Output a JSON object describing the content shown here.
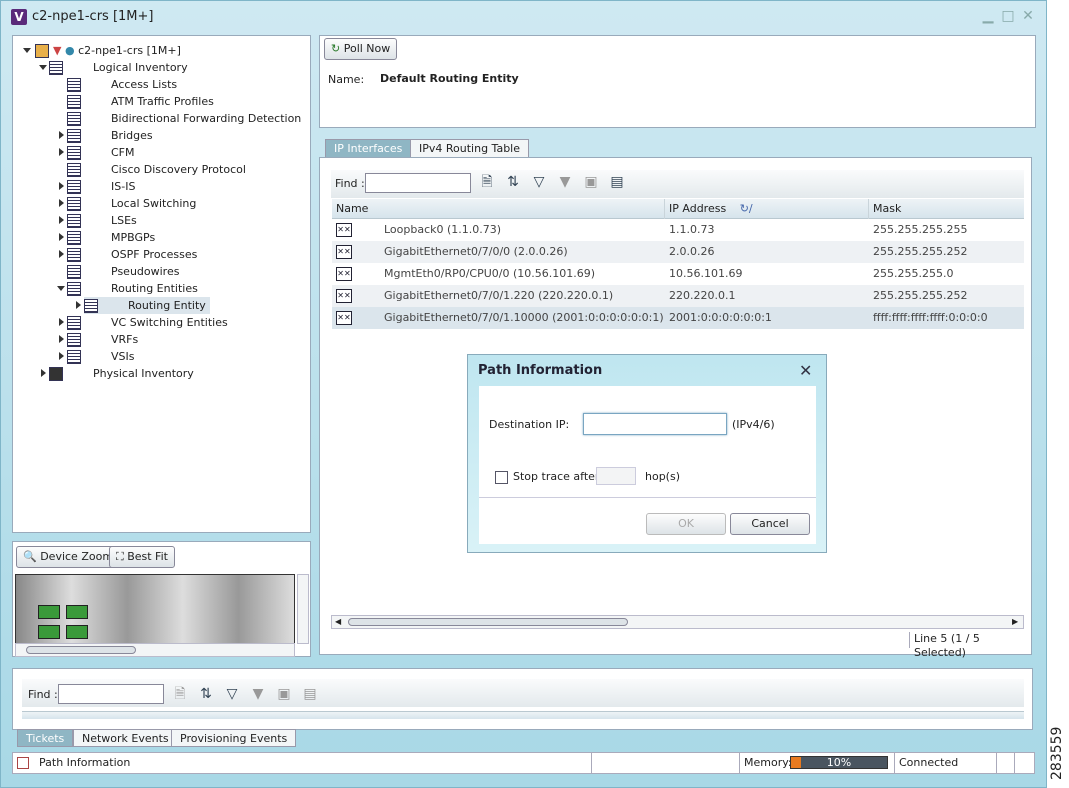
{
  "window": {
    "title": "c2-npe1-crs [1M+]",
    "app_icon": "V"
  },
  "tree": {
    "root": "c2-npe1-crs [1M+]",
    "items": [
      {
        "label": "Logical Inventory",
        "level": 1
      },
      {
        "label": "Access Lists",
        "level": 2
      },
      {
        "label": "ATM Traffic Profiles",
        "level": 2
      },
      {
        "label": "Bidirectional Forwarding Detection",
        "level": 2
      },
      {
        "label": "Bridges",
        "level": 2
      },
      {
        "label": "CFM",
        "level": 2
      },
      {
        "label": "Cisco Discovery Protocol",
        "level": 2
      },
      {
        "label": "IS-IS",
        "level": 2
      },
      {
        "label": "Local Switching",
        "level": 2
      },
      {
        "label": "LSEs",
        "level": 2
      },
      {
        "label": "MPBGPs",
        "level": 2
      },
      {
        "label": "OSPF Processes",
        "level": 2
      },
      {
        "label": "Pseudowires",
        "level": 2
      },
      {
        "label": "Routing Entities",
        "level": 2
      },
      {
        "label": "Routing Entity",
        "level": 3
      },
      {
        "label": "VC Switching Entities",
        "level": 2
      },
      {
        "label": "VRFs",
        "level": 2
      },
      {
        "label": "VSIs",
        "level": 2
      },
      {
        "label": "Physical Inventory",
        "level": 1
      }
    ]
  },
  "overview": {
    "device_zoom": "Device Zoom",
    "best_fit": "Best Fit"
  },
  "details": {
    "poll_now": "Poll Now",
    "name_label": "Name:",
    "name_value": "Default Routing Entity"
  },
  "tabs": {
    "ip_interfaces": "IP Interfaces",
    "ipv4_routing": "IPv4 Routing Table"
  },
  "find": {
    "label": "Find :"
  },
  "table": {
    "headers": [
      "Name",
      "IP Address",
      "Mask"
    ],
    "rows": [
      [
        "Loopback0 (1.1.0.73)",
        "1.1.0.73",
        "255.255.255.255"
      ],
      [
        "GigabitEthernet0/7/0/0 (2.0.0.26)",
        "2.0.0.26",
        "255.255.255.252"
      ],
      [
        "MgmtEth0/RP0/CPU0/0 (10.56.101.69)",
        "10.56.101.69",
        "255.255.255.0"
      ],
      [
        "GigabitEthernet0/7/0/1.220 (220.220.0.1)",
        "220.220.0.1",
        "255.255.255.252"
      ],
      [
        "GigabitEthernet0/7/0/1.10000 (2001:0:0:0:0:0:0:1)",
        "2001:0:0:0:0:0:0:1",
        "ffff:ffff:ffff:ffff:0:0:0:0"
      ]
    ],
    "status": "Line 5 (1 / 5 Selected)"
  },
  "dialog": {
    "title": "Path Information",
    "dest_label": "Destination IP:",
    "dest_value": "",
    "dest_suffix": "(IPv4/6)",
    "stop_label": "Stop trace after",
    "hops_suffix": "hop(s)",
    "ok": "OK",
    "cancel": "Cancel"
  },
  "bottom": {
    "find_label": "Find :",
    "tabs": [
      "Tickets",
      "Network Events",
      "Provisioning Events"
    ]
  },
  "statusbar": {
    "message": "Path Information",
    "memory_label": "Memory:",
    "memory_value": "10%",
    "memory_fraction": 0.1,
    "connection": "Connected"
  },
  "side_label": "283559"
}
